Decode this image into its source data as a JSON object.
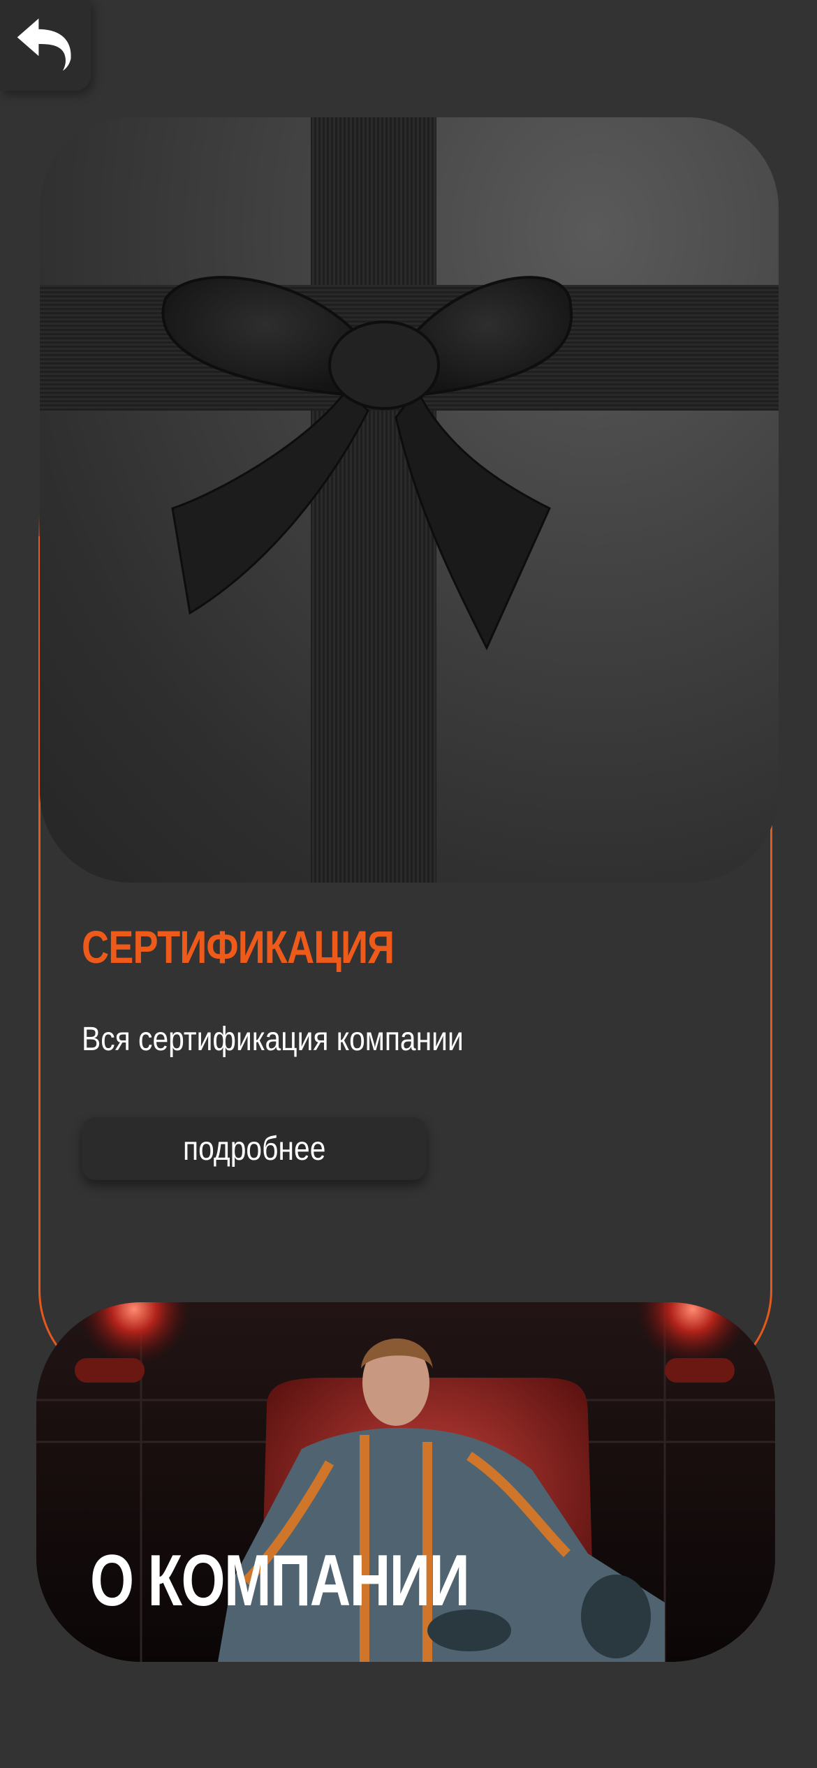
{
  "nav": {
    "back_icon": "undo-arrow-icon"
  },
  "certification": {
    "title": "СЕРТИФИКАЦИЯ",
    "description": "Вся сертификация компании",
    "button_label": "подробнее",
    "accent_color": "#ee5a1a",
    "image": "black-gift-box-with-ribbon-bow"
  },
  "company": {
    "title": "О КОМПАНИИ",
    "image": "man-in-red-armchair"
  },
  "colors": {
    "background": "#333333",
    "button": "#2b2b2b",
    "text": "#ffffff"
  }
}
